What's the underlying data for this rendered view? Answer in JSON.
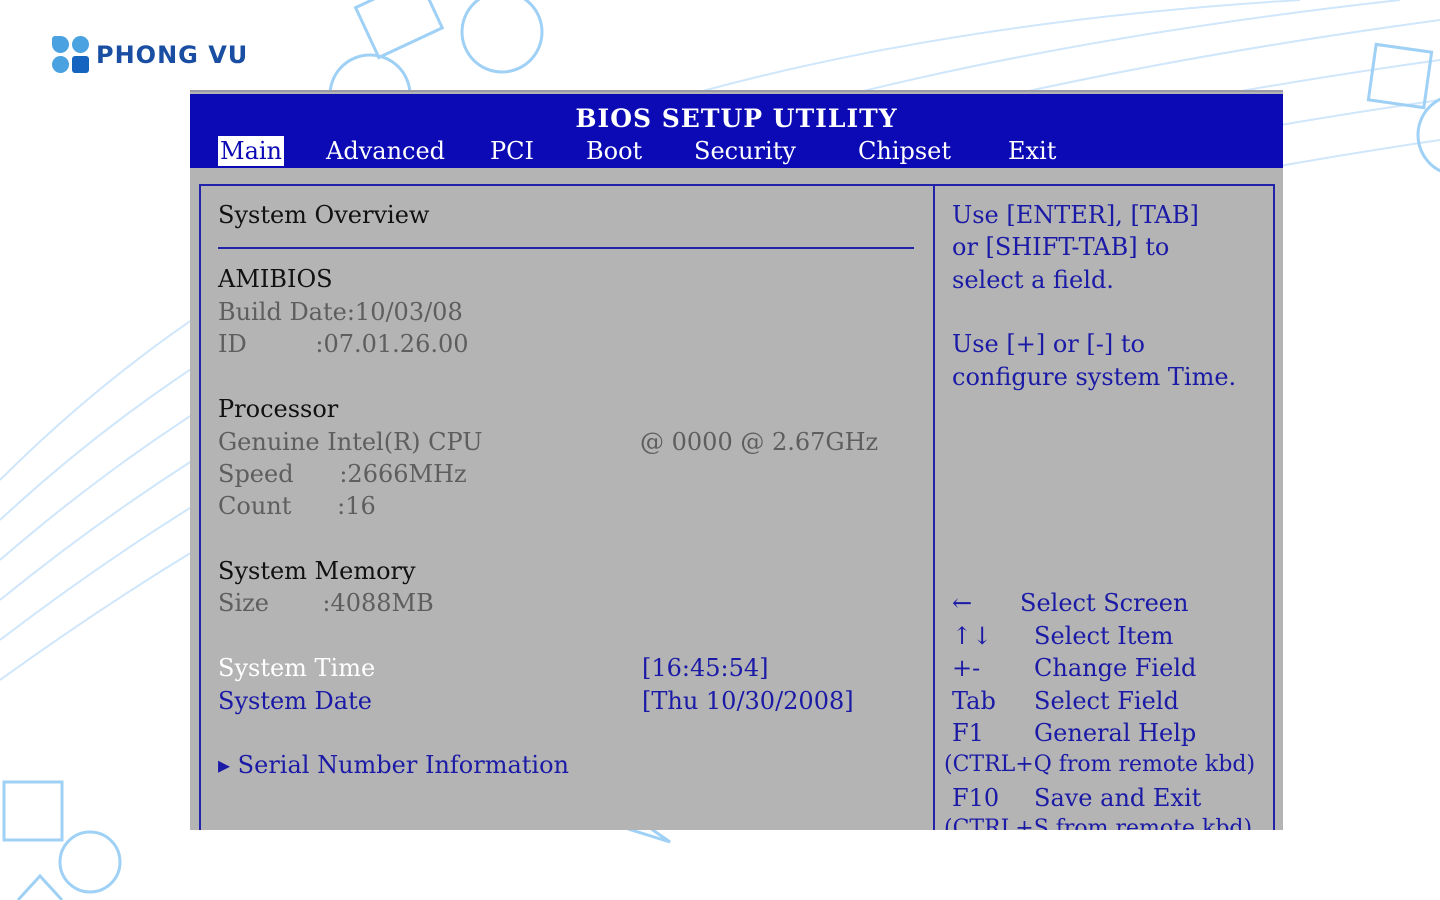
{
  "brand": {
    "name": "PHONG VU"
  },
  "bios": {
    "title": "BIOS SETUP UTILITY",
    "tabs": [
      {
        "label": "Main",
        "active": true
      },
      {
        "label": "Advanced"
      },
      {
        "label": "PCI"
      },
      {
        "label": "Boot"
      },
      {
        "label": "Security"
      },
      {
        "label": "Chipset"
      },
      {
        "label": "Exit"
      }
    ],
    "overview": {
      "heading": "System Overview",
      "amibios": {
        "heading": "AMIBIOS",
        "build_date": "Build Date:10/03/08",
        "id": "ID         :07.01.26.00"
      },
      "processor": {
        "heading": "Processor",
        "name": "Genuine Intel(R) CPU",
        "name_value": "@ 0000 @ 2.67GHz",
        "speed": "Speed      :2666MHz",
        "count": "Count      :16"
      },
      "memory": {
        "heading": "System Memory",
        "size": "Size       :4088MB"
      },
      "system_time": {
        "label": "System Time",
        "value": "[16:45:54]"
      },
      "system_date": {
        "label": "System Date",
        "value": "[Thu 10/30/2008]"
      },
      "serial_number": "▸ Serial Number Information"
    },
    "help": {
      "lines": [
        "Use [ENTER], [TAB]",
        "or [SHIFT-TAB] to",
        "select a field.",
        "",
        "Use [+] or [-] to",
        "configure system Time."
      ]
    },
    "keys": [
      {
        "key": "←",
        "action": "Select Screen"
      },
      {
        "key": "↑↓",
        "action": "Select Item"
      },
      {
        "key": "+-",
        "action": "Change Field"
      },
      {
        "key": "Tab",
        "action": "Select Field"
      },
      {
        "key": "F1",
        "action": "General Help"
      },
      {
        "key": "",
        "action": "(CTRL+Q from remote kbd)"
      },
      {
        "key": "F10",
        "action": "Save and Exit"
      },
      {
        "key": "",
        "action": "(CTRL+S from remote kbd)"
      }
    ]
  },
  "colors": {
    "header_blue": "#0c0ab4",
    "bios_gray": "#b4b4b4",
    "brand_blue": "#1a4ea3"
  }
}
